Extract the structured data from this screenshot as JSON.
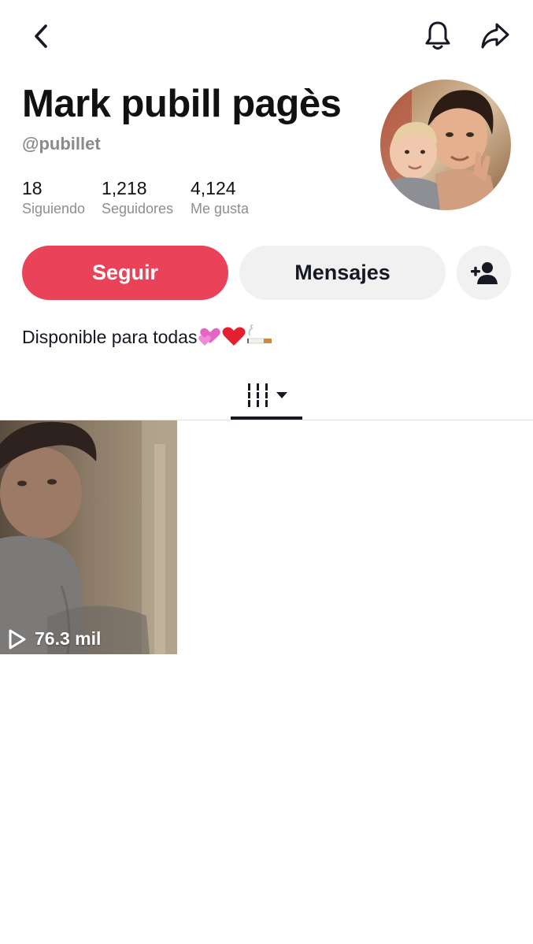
{
  "profile": {
    "display_name": "Mark pubill pagès",
    "username": "@pubillet",
    "stats": {
      "following": {
        "value": "18",
        "label": "Siguiendo"
      },
      "followers": {
        "value": "1,218",
        "label": "Seguidores"
      },
      "likes": {
        "value": "4,124",
        "label": "Me gusta"
      }
    },
    "bio": "Disponible para todas"
  },
  "actions": {
    "follow_label": "Seguir",
    "message_label": "Mensajes"
  },
  "videos": [
    {
      "views": "76.3 mil"
    }
  ],
  "icons": {
    "back": "chevron-left-icon",
    "notifications": "bell-icon",
    "share": "share-arrow-icon",
    "add_friend": "add-user-icon",
    "grid_tab": "video-grid-icon",
    "play": "play-icon"
  },
  "colors": {
    "accent": "#ea4359",
    "secondary_button": "#f1f1f2",
    "muted_text": "#8a8a8a"
  }
}
